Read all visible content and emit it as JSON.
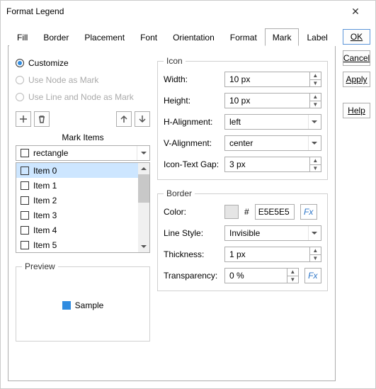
{
  "window": {
    "title": "Format Legend"
  },
  "tabs": [
    "Fill",
    "Border",
    "Placement",
    "Font",
    "Orientation",
    "Format",
    "Mark",
    "Label"
  ],
  "activeTab": "Mark",
  "radios": {
    "customize": "Customize",
    "useNode": "Use Node as Mark",
    "useLineNode": "Use Line and Node as Mark"
  },
  "markItemsHeading": "Mark Items",
  "markCombo": "rectangle",
  "items": [
    "Item 0",
    "Item 1",
    "Item 2",
    "Item 3",
    "Item 4",
    "Item 5"
  ],
  "preview": {
    "legend": "Preview",
    "label": "Sample"
  },
  "iconGroup": {
    "legend": "Icon",
    "width": {
      "label": "Width:",
      "value": "10 px"
    },
    "height": {
      "label": "Height:",
      "value": "10 px"
    },
    "halign": {
      "label": "H-Alignment:",
      "value": "left"
    },
    "valign": {
      "label": "V-Alignment:",
      "value": "center"
    },
    "gap": {
      "label": "Icon-Text Gap:",
      "value": "3 px"
    }
  },
  "borderGroup": {
    "legend": "Border",
    "color": {
      "label": "Color:",
      "hash": "#",
      "hex": "E5E5E5",
      "fx": "Fx"
    },
    "lineStyle": {
      "label": "Line Style:",
      "value": "Invisible"
    },
    "thickness": {
      "label": "Thickness:",
      "value": "1 px"
    },
    "transparency": {
      "label": "Transparency:",
      "value": "0 %",
      "fx": "Fx"
    }
  },
  "buttons": {
    "ok": "OK",
    "cancel": "Cancel",
    "apply": "Apply",
    "help": "Help"
  }
}
